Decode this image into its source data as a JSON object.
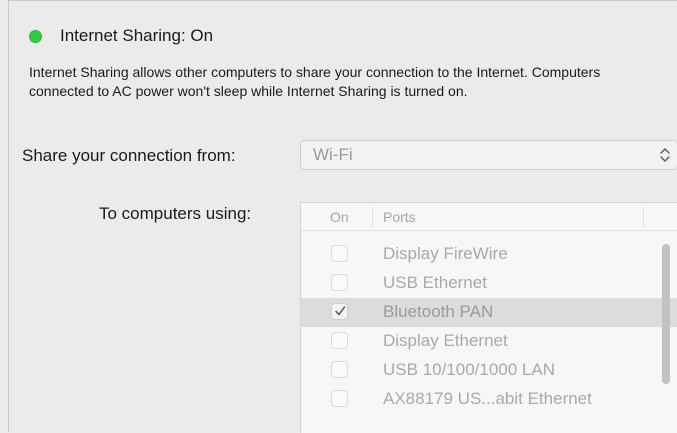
{
  "status": {
    "text": "Internet Sharing: On",
    "indicator_color": "#2ecc40"
  },
  "description": "Internet Sharing allows other computers to share your connection to the Internet. Computers connected to AC power won't sleep while Internet Sharing is turned on.",
  "share_from": {
    "label": "Share your connection from:",
    "selected_value": "Wi-Fi"
  },
  "to_computers": {
    "label": "To computers using:",
    "columns": [
      "On",
      "Ports"
    ],
    "ports": [
      {
        "name": "Display FireWire",
        "checked": false,
        "selected": false
      },
      {
        "name": "USB Ethernet",
        "checked": false,
        "selected": false
      },
      {
        "name": "Bluetooth PAN",
        "checked": true,
        "selected": true
      },
      {
        "name": "Display Ethernet",
        "checked": false,
        "selected": false
      },
      {
        "name": "USB 10/100/1000 LAN",
        "checked": false,
        "selected": false
      },
      {
        "name": "AX88179 US...abit Ethernet",
        "checked": false,
        "selected": false
      }
    ]
  },
  "icons": {
    "status": "green-status-dot",
    "select_chevron": "up-down-chevron-icon",
    "checkmark": "checkmark-icon"
  }
}
